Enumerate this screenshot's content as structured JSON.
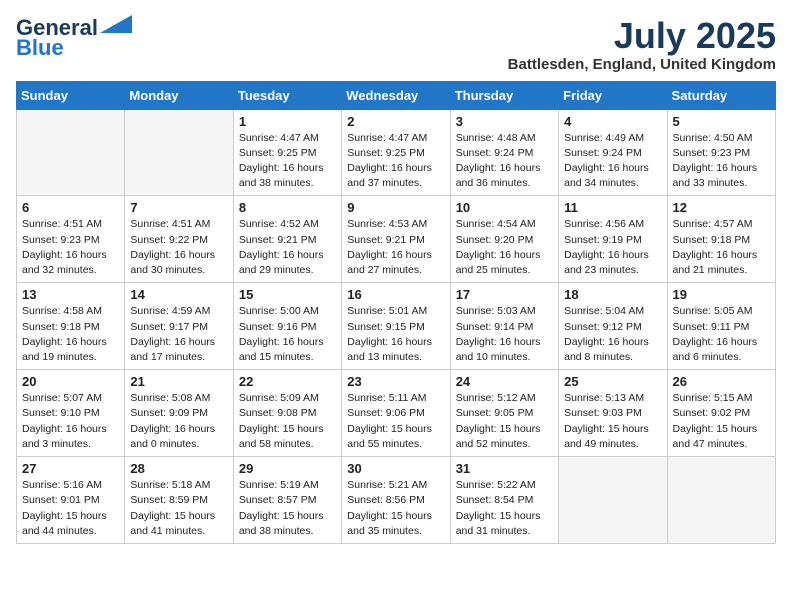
{
  "logo": {
    "line1": "General",
    "line2": "Blue"
  },
  "title": "July 2025",
  "location": "Battlesden, England, United Kingdom",
  "weekdays": [
    "Sunday",
    "Monday",
    "Tuesday",
    "Wednesday",
    "Thursday",
    "Friday",
    "Saturday"
  ],
  "weeks": [
    [
      {
        "day": "",
        "info": ""
      },
      {
        "day": "",
        "info": ""
      },
      {
        "day": "1",
        "info": "Sunrise: 4:47 AM\nSunset: 9:25 PM\nDaylight: 16 hours\nand 38 minutes."
      },
      {
        "day": "2",
        "info": "Sunrise: 4:47 AM\nSunset: 9:25 PM\nDaylight: 16 hours\nand 37 minutes."
      },
      {
        "day": "3",
        "info": "Sunrise: 4:48 AM\nSunset: 9:24 PM\nDaylight: 16 hours\nand 36 minutes."
      },
      {
        "day": "4",
        "info": "Sunrise: 4:49 AM\nSunset: 9:24 PM\nDaylight: 16 hours\nand 34 minutes."
      },
      {
        "day": "5",
        "info": "Sunrise: 4:50 AM\nSunset: 9:23 PM\nDaylight: 16 hours\nand 33 minutes."
      }
    ],
    [
      {
        "day": "6",
        "info": "Sunrise: 4:51 AM\nSunset: 9:23 PM\nDaylight: 16 hours\nand 32 minutes."
      },
      {
        "day": "7",
        "info": "Sunrise: 4:51 AM\nSunset: 9:22 PM\nDaylight: 16 hours\nand 30 minutes."
      },
      {
        "day": "8",
        "info": "Sunrise: 4:52 AM\nSunset: 9:21 PM\nDaylight: 16 hours\nand 29 minutes."
      },
      {
        "day": "9",
        "info": "Sunrise: 4:53 AM\nSunset: 9:21 PM\nDaylight: 16 hours\nand 27 minutes."
      },
      {
        "day": "10",
        "info": "Sunrise: 4:54 AM\nSunset: 9:20 PM\nDaylight: 16 hours\nand 25 minutes."
      },
      {
        "day": "11",
        "info": "Sunrise: 4:56 AM\nSunset: 9:19 PM\nDaylight: 16 hours\nand 23 minutes."
      },
      {
        "day": "12",
        "info": "Sunrise: 4:57 AM\nSunset: 9:18 PM\nDaylight: 16 hours\nand 21 minutes."
      }
    ],
    [
      {
        "day": "13",
        "info": "Sunrise: 4:58 AM\nSunset: 9:18 PM\nDaylight: 16 hours\nand 19 minutes."
      },
      {
        "day": "14",
        "info": "Sunrise: 4:59 AM\nSunset: 9:17 PM\nDaylight: 16 hours\nand 17 minutes."
      },
      {
        "day": "15",
        "info": "Sunrise: 5:00 AM\nSunset: 9:16 PM\nDaylight: 16 hours\nand 15 minutes."
      },
      {
        "day": "16",
        "info": "Sunrise: 5:01 AM\nSunset: 9:15 PM\nDaylight: 16 hours\nand 13 minutes."
      },
      {
        "day": "17",
        "info": "Sunrise: 5:03 AM\nSunset: 9:14 PM\nDaylight: 16 hours\nand 10 minutes."
      },
      {
        "day": "18",
        "info": "Sunrise: 5:04 AM\nSunset: 9:12 PM\nDaylight: 16 hours\nand 8 minutes."
      },
      {
        "day": "19",
        "info": "Sunrise: 5:05 AM\nSunset: 9:11 PM\nDaylight: 16 hours\nand 6 minutes."
      }
    ],
    [
      {
        "day": "20",
        "info": "Sunrise: 5:07 AM\nSunset: 9:10 PM\nDaylight: 16 hours\nand 3 minutes."
      },
      {
        "day": "21",
        "info": "Sunrise: 5:08 AM\nSunset: 9:09 PM\nDaylight: 16 hours\nand 0 minutes."
      },
      {
        "day": "22",
        "info": "Sunrise: 5:09 AM\nSunset: 9:08 PM\nDaylight: 15 hours\nand 58 minutes."
      },
      {
        "day": "23",
        "info": "Sunrise: 5:11 AM\nSunset: 9:06 PM\nDaylight: 15 hours\nand 55 minutes."
      },
      {
        "day": "24",
        "info": "Sunrise: 5:12 AM\nSunset: 9:05 PM\nDaylight: 15 hours\nand 52 minutes."
      },
      {
        "day": "25",
        "info": "Sunrise: 5:13 AM\nSunset: 9:03 PM\nDaylight: 15 hours\nand 49 minutes."
      },
      {
        "day": "26",
        "info": "Sunrise: 5:15 AM\nSunset: 9:02 PM\nDaylight: 15 hours\nand 47 minutes."
      }
    ],
    [
      {
        "day": "27",
        "info": "Sunrise: 5:16 AM\nSunset: 9:01 PM\nDaylight: 15 hours\nand 44 minutes."
      },
      {
        "day": "28",
        "info": "Sunrise: 5:18 AM\nSunset: 8:59 PM\nDaylight: 15 hours\nand 41 minutes."
      },
      {
        "day": "29",
        "info": "Sunrise: 5:19 AM\nSunset: 8:57 PM\nDaylight: 15 hours\nand 38 minutes."
      },
      {
        "day": "30",
        "info": "Sunrise: 5:21 AM\nSunset: 8:56 PM\nDaylight: 15 hours\nand 35 minutes."
      },
      {
        "day": "31",
        "info": "Sunrise: 5:22 AM\nSunset: 8:54 PM\nDaylight: 15 hours\nand 31 minutes."
      },
      {
        "day": "",
        "info": ""
      },
      {
        "day": "",
        "info": ""
      }
    ]
  ]
}
